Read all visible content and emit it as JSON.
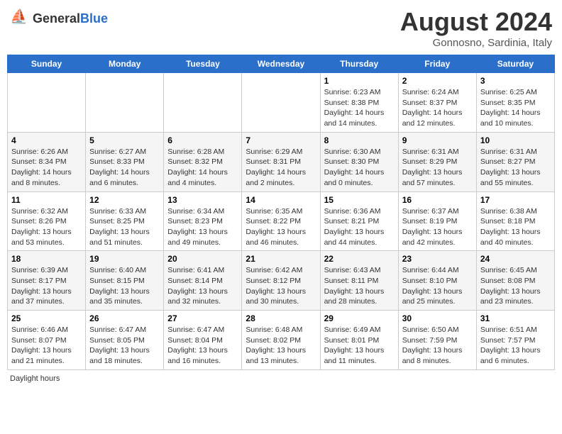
{
  "logo": {
    "text_general": "General",
    "text_blue": "Blue"
  },
  "title": "August 2024",
  "subtitle": "Gonnosno, Sardinia, Italy",
  "days_of_week": [
    "Sunday",
    "Monday",
    "Tuesday",
    "Wednesday",
    "Thursday",
    "Friday",
    "Saturday"
  ],
  "footer": "Daylight hours",
  "weeks": [
    [
      {
        "day": "",
        "info": ""
      },
      {
        "day": "",
        "info": ""
      },
      {
        "day": "",
        "info": ""
      },
      {
        "day": "",
        "info": ""
      },
      {
        "day": "1",
        "info": "Sunrise: 6:23 AM\nSunset: 8:38 PM\nDaylight: 14 hours and 14 minutes."
      },
      {
        "day": "2",
        "info": "Sunrise: 6:24 AM\nSunset: 8:37 PM\nDaylight: 14 hours and 12 minutes."
      },
      {
        "day": "3",
        "info": "Sunrise: 6:25 AM\nSunset: 8:35 PM\nDaylight: 14 hours and 10 minutes."
      }
    ],
    [
      {
        "day": "4",
        "info": "Sunrise: 6:26 AM\nSunset: 8:34 PM\nDaylight: 14 hours and 8 minutes."
      },
      {
        "day": "5",
        "info": "Sunrise: 6:27 AM\nSunset: 8:33 PM\nDaylight: 14 hours and 6 minutes."
      },
      {
        "day": "6",
        "info": "Sunrise: 6:28 AM\nSunset: 8:32 PM\nDaylight: 14 hours and 4 minutes."
      },
      {
        "day": "7",
        "info": "Sunrise: 6:29 AM\nSunset: 8:31 PM\nDaylight: 14 hours and 2 minutes."
      },
      {
        "day": "8",
        "info": "Sunrise: 6:30 AM\nSunset: 8:30 PM\nDaylight: 14 hours and 0 minutes."
      },
      {
        "day": "9",
        "info": "Sunrise: 6:31 AM\nSunset: 8:29 PM\nDaylight: 13 hours and 57 minutes."
      },
      {
        "day": "10",
        "info": "Sunrise: 6:31 AM\nSunset: 8:27 PM\nDaylight: 13 hours and 55 minutes."
      }
    ],
    [
      {
        "day": "11",
        "info": "Sunrise: 6:32 AM\nSunset: 8:26 PM\nDaylight: 13 hours and 53 minutes."
      },
      {
        "day": "12",
        "info": "Sunrise: 6:33 AM\nSunset: 8:25 PM\nDaylight: 13 hours and 51 minutes."
      },
      {
        "day": "13",
        "info": "Sunrise: 6:34 AM\nSunset: 8:23 PM\nDaylight: 13 hours and 49 minutes."
      },
      {
        "day": "14",
        "info": "Sunrise: 6:35 AM\nSunset: 8:22 PM\nDaylight: 13 hours and 46 minutes."
      },
      {
        "day": "15",
        "info": "Sunrise: 6:36 AM\nSunset: 8:21 PM\nDaylight: 13 hours and 44 minutes."
      },
      {
        "day": "16",
        "info": "Sunrise: 6:37 AM\nSunset: 8:19 PM\nDaylight: 13 hours and 42 minutes."
      },
      {
        "day": "17",
        "info": "Sunrise: 6:38 AM\nSunset: 8:18 PM\nDaylight: 13 hours and 40 minutes."
      }
    ],
    [
      {
        "day": "18",
        "info": "Sunrise: 6:39 AM\nSunset: 8:17 PM\nDaylight: 13 hours and 37 minutes."
      },
      {
        "day": "19",
        "info": "Sunrise: 6:40 AM\nSunset: 8:15 PM\nDaylight: 13 hours and 35 minutes."
      },
      {
        "day": "20",
        "info": "Sunrise: 6:41 AM\nSunset: 8:14 PM\nDaylight: 13 hours and 32 minutes."
      },
      {
        "day": "21",
        "info": "Sunrise: 6:42 AM\nSunset: 8:12 PM\nDaylight: 13 hours and 30 minutes."
      },
      {
        "day": "22",
        "info": "Sunrise: 6:43 AM\nSunset: 8:11 PM\nDaylight: 13 hours and 28 minutes."
      },
      {
        "day": "23",
        "info": "Sunrise: 6:44 AM\nSunset: 8:10 PM\nDaylight: 13 hours and 25 minutes."
      },
      {
        "day": "24",
        "info": "Sunrise: 6:45 AM\nSunset: 8:08 PM\nDaylight: 13 hours and 23 minutes."
      }
    ],
    [
      {
        "day": "25",
        "info": "Sunrise: 6:46 AM\nSunset: 8:07 PM\nDaylight: 13 hours and 21 minutes."
      },
      {
        "day": "26",
        "info": "Sunrise: 6:47 AM\nSunset: 8:05 PM\nDaylight: 13 hours and 18 minutes."
      },
      {
        "day": "27",
        "info": "Sunrise: 6:47 AM\nSunset: 8:04 PM\nDaylight: 13 hours and 16 minutes."
      },
      {
        "day": "28",
        "info": "Sunrise: 6:48 AM\nSunset: 8:02 PM\nDaylight: 13 hours and 13 minutes."
      },
      {
        "day": "29",
        "info": "Sunrise: 6:49 AM\nSunset: 8:01 PM\nDaylight: 13 hours and 11 minutes."
      },
      {
        "day": "30",
        "info": "Sunrise: 6:50 AM\nSunset: 7:59 PM\nDaylight: 13 hours and 8 minutes."
      },
      {
        "day": "31",
        "info": "Sunrise: 6:51 AM\nSunset: 7:57 PM\nDaylight: 13 hours and 6 minutes."
      }
    ]
  ]
}
